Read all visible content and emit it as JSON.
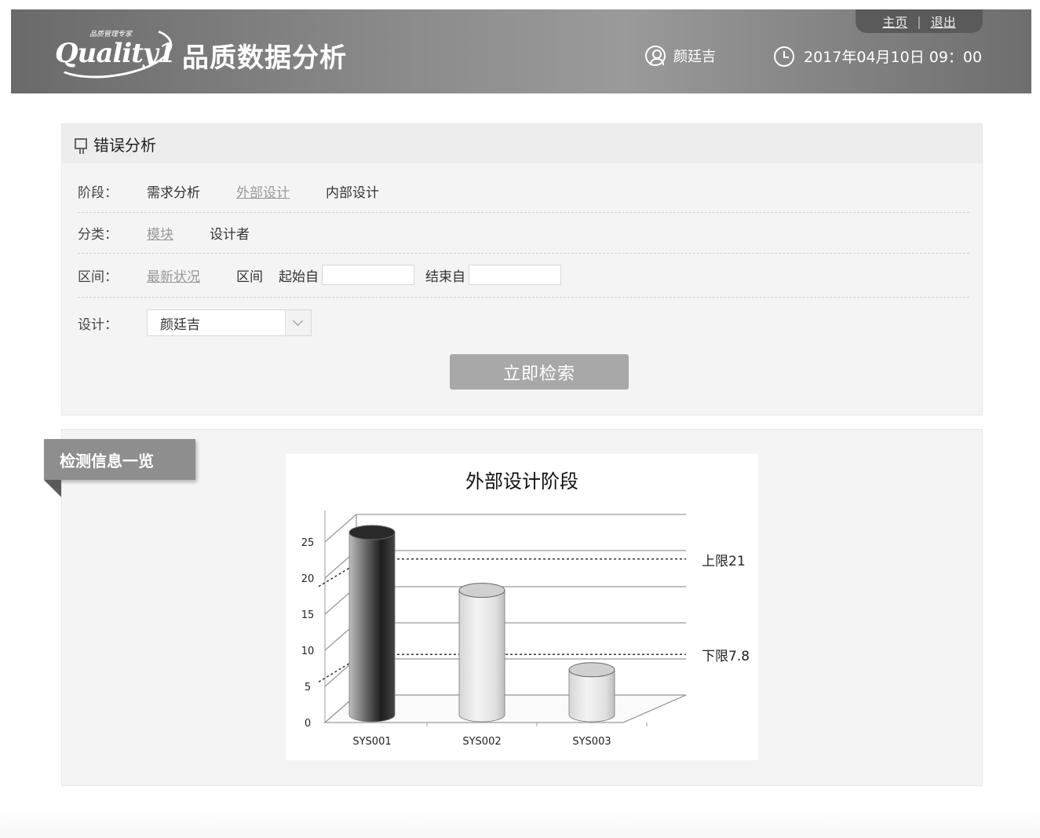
{
  "header": {
    "logo_tagline": "品质管理专家",
    "logo_word": "Quality1",
    "title": "品质数据分析",
    "links": {
      "home": "主页",
      "separator": "|",
      "logout": "退出"
    },
    "user_name": "颜廷吉",
    "datetime": "2017年04月10日 09：00"
  },
  "error_panel": {
    "title": "错误分析",
    "stage": {
      "label": "阶段：",
      "options": [
        "需求分析",
        "外部设计",
        "内部设计"
      ],
      "active_index": 1
    },
    "category": {
      "label": "分类：",
      "options": [
        "模块",
        "设计者"
      ],
      "active_index": 0
    },
    "range": {
      "label": "区间：",
      "latest": "最新状况",
      "range_label": "区间",
      "start_label": "起始自",
      "start_value": "",
      "end_label": "结束自",
      "end_value": ""
    },
    "designer": {
      "label": "设计：",
      "selected": "颜廷吉"
    },
    "search_button": "立即检索"
  },
  "detection_panel": {
    "title": "检测信息一览"
  },
  "chart_data": {
    "type": "bar",
    "title": "外部设计阶段",
    "categories": [
      "SYS001",
      "SYS002",
      "SYS003"
    ],
    "values": [
      25,
      17,
      6
    ],
    "ylim": [
      0,
      25
    ],
    "yticks": [
      0,
      5,
      10,
      15,
      20,
      25
    ],
    "grid": true,
    "reference_lines": [
      {
        "label": "上限21",
        "value": 21
      },
      {
        "label": "下限7.8",
        "value": 7.8
      }
    ],
    "colors": {
      "bar_primary": "#1e1e1e",
      "bar_other": "#e0e0e0",
      "grid": "#9a9a9a"
    }
  }
}
